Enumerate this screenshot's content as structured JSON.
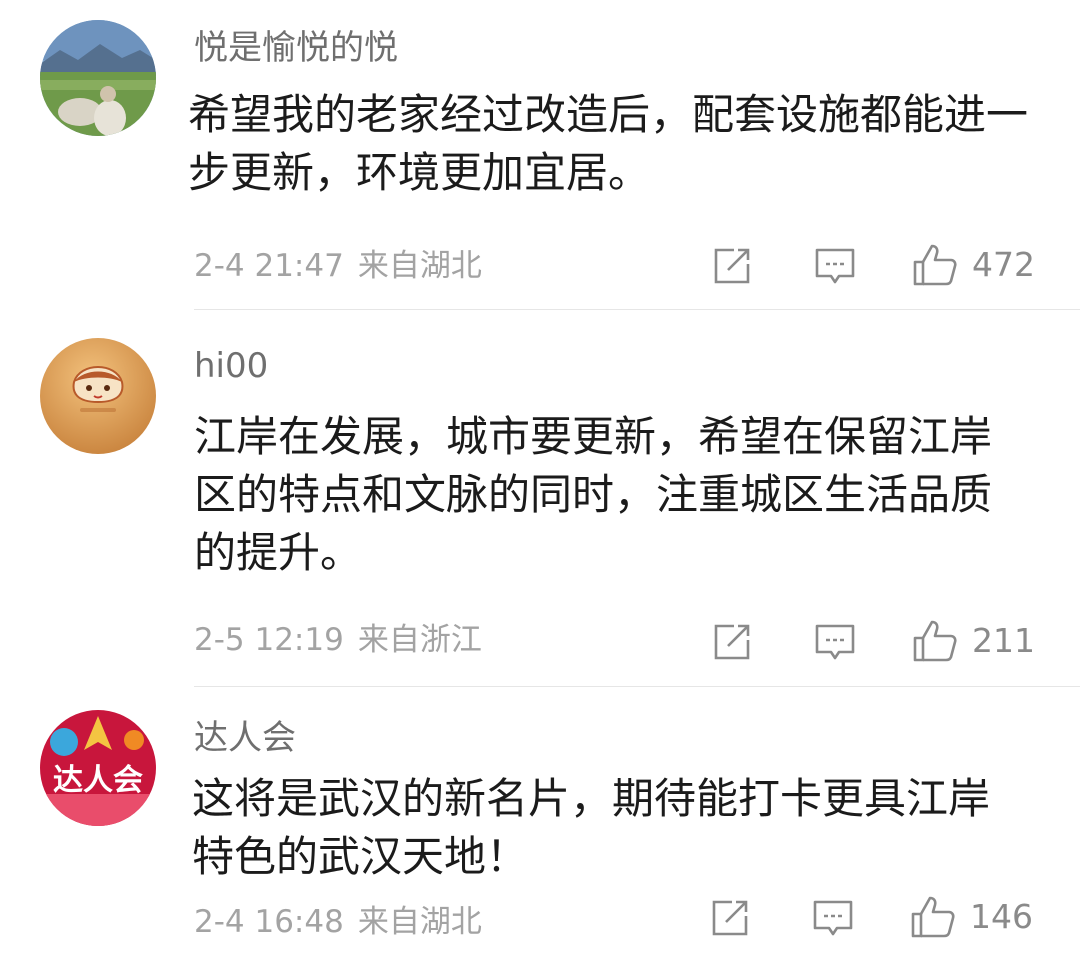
{
  "comments": [
    {
      "username": "悦是愉悦的悦",
      "content": "希望我的老家经过改造后，配套设施都能进一步更新，环境更加宜居。",
      "date": "2-4 21:47",
      "location": "来自湖北",
      "likes": "472",
      "avatar": "landscape-photo-avatar"
    },
    {
      "username": "hi00",
      "content": "江岸在发展，城市要更新，希望在保留江岸区的特点和文脉的同时，注重城区生活品质的提升。",
      "date": "2-5 12:19",
      "location": "来自浙江",
      "likes": "211",
      "avatar": "cartoon-face-avatar"
    },
    {
      "username": "达人会",
      "content": "这将是武汉的新名片，期待能打卡更具江岸特色的武汉天地！",
      "date": "2-4 16:48",
      "location": "来自湖北",
      "likes": "146",
      "avatar": "darenhui-logo-avatar",
      "avatar_text": "达人会"
    }
  ],
  "icons": {
    "share": "share-icon",
    "reply": "comment-icon",
    "like": "thumbs-up-icon"
  },
  "colors": {
    "text": "#1b1b1b",
    "username": "#6f6f6f",
    "meta": "#a3a3a3",
    "icon": "#8a8a8a",
    "divider": "#e6e6e6"
  }
}
